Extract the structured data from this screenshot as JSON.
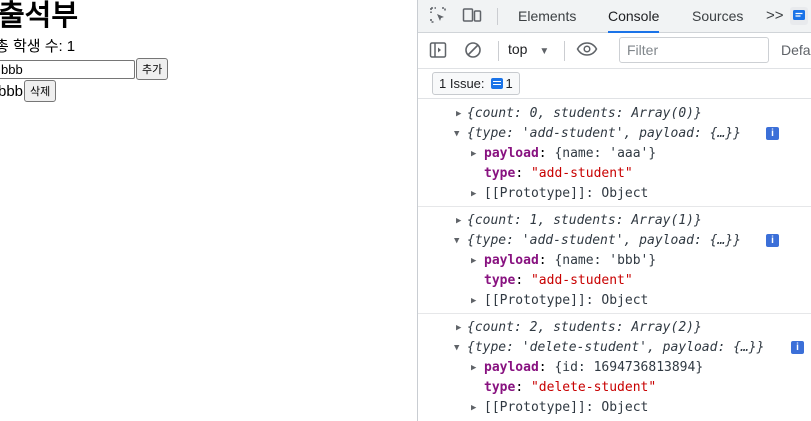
{
  "app": {
    "title": "출석부",
    "count_label": "총 학생 수:",
    "count_value": "1",
    "input_value": "bbb",
    "add_button": "추가",
    "students": [
      {
        "name": "bbb",
        "delete_button": "삭제"
      }
    ]
  },
  "devtools": {
    "tabs": [
      "Elements",
      "Console",
      "Sources"
    ],
    "active_tab": "Console",
    "more_tabs": ">>",
    "context": "top",
    "filter_placeholder": "Filter",
    "levels": "Default levels",
    "issues_label": "1 Issue:",
    "issues_count": "1",
    "logs": [
      {
        "state": "{count: 0, students: Array(0)}",
        "action": "{type: 'add-student', payload: {…}}",
        "payload_key": "payload",
        "payload_value": "{name: 'aaa'}",
        "type_key": "type",
        "type_value": "\"add-student\"",
        "proto": "[[Prototype]]: Object"
      },
      {
        "state": "{count: 1, students: Array(1)}",
        "action": "{type: 'add-student', payload: {…}}",
        "payload_key": "payload",
        "payload_value": "{name: 'bbb'}",
        "type_key": "type",
        "type_value": "\"add-student\"",
        "proto": "[[Prototype]]: Object"
      },
      {
        "state": "{count: 2, students: Array(2)}",
        "action": "{type: 'delete-student', payload: {…}}",
        "payload_key": "payload",
        "payload_value": "{id: 1694736813894}",
        "type_key": "type",
        "type_value": "\"delete-student\"",
        "proto": "[[Prototype]]: Object"
      }
    ]
  }
}
